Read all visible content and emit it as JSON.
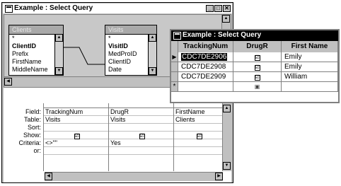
{
  "query_window": {
    "title": "Example : Select Query",
    "controls": {
      "minimize": "_",
      "maximize": "□",
      "close": "✕"
    },
    "tables": [
      {
        "name": "Clients",
        "fields": [
          "*",
          "ClientID",
          "Prefix",
          "FirstName",
          "MiddleName"
        ]
      },
      {
        "name": "Visits",
        "fields": [
          "*",
          "VisitID",
          "MedProID",
          "ClientID",
          "Date"
        ]
      }
    ],
    "grid": {
      "row_labels": [
        "Field:",
        "Table:",
        "Sort:",
        "Show:",
        "Criteria:",
        "or:"
      ],
      "columns": [
        {
          "field": "TrackingNum",
          "table": "Visits",
          "show": "☑",
          "criteria": "<>\"\""
        },
        {
          "field": "DrugR",
          "table": "Visits",
          "show": "☑",
          "criteria": "Yes"
        },
        {
          "field": "FirstName",
          "table": "Clients",
          "show": "☑",
          "criteria": ""
        }
      ]
    }
  },
  "datasheet_window": {
    "title": "Example : Select Query",
    "columns": [
      "TrackingNum",
      "DrugR",
      "First Name"
    ],
    "rows": [
      {
        "tracking": "CDC7DE2906",
        "drug": "☑",
        "first": "Emily",
        "selector": "▶"
      },
      {
        "tracking": "CDC7DE2908",
        "drug": "☑",
        "first": "Emily",
        "selector": ""
      },
      {
        "tracking": "CDC7DE2909",
        "drug": "☑",
        "first": "William",
        "selector": ""
      }
    ],
    "new_row_marker": "*",
    "new_row_checkbox": "▣"
  }
}
